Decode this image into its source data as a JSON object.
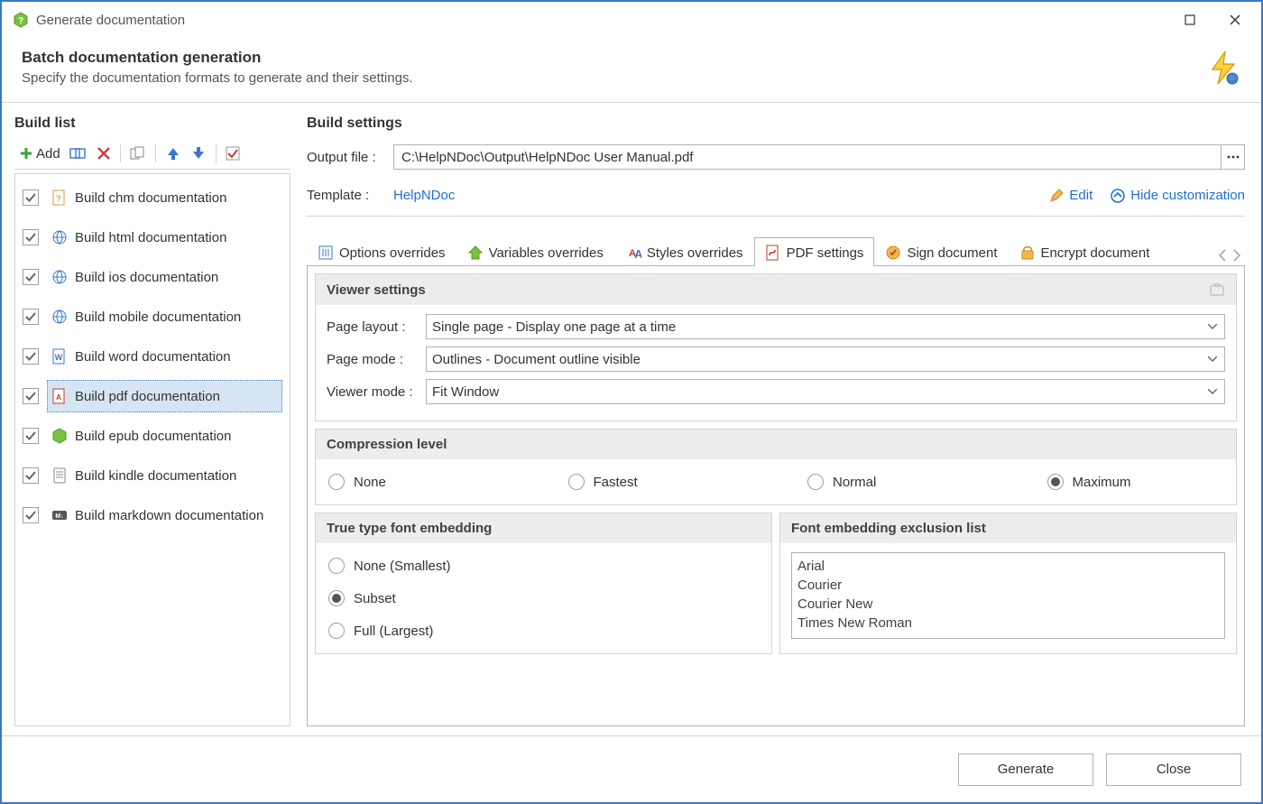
{
  "window": {
    "title": "Generate documentation"
  },
  "banner": {
    "title": "Batch documentation generation",
    "subtitle": "Specify the documentation formats to generate and their settings."
  },
  "side": {
    "heading": "Build list",
    "add_label": "Add",
    "items": [
      {
        "label": "Build chm documentation",
        "checked": true,
        "icon": "chm"
      },
      {
        "label": "Build html documentation",
        "checked": true,
        "icon": "html"
      },
      {
        "label": "Build ios documentation",
        "checked": true,
        "icon": "ios"
      },
      {
        "label": "Build mobile documentation",
        "checked": true,
        "icon": "mobile"
      },
      {
        "label": "Build word documentation",
        "checked": true,
        "icon": "word"
      },
      {
        "label": "Build pdf documentation",
        "checked": true,
        "icon": "pdf",
        "selected": true
      },
      {
        "label": "Build epub documentation",
        "checked": true,
        "icon": "epub"
      },
      {
        "label": "Build kindle documentation",
        "checked": true,
        "icon": "kindle"
      },
      {
        "label": "Build markdown documentation",
        "checked": true,
        "icon": "md"
      }
    ]
  },
  "settings": {
    "heading": "Build settings",
    "output_label": "Output file :",
    "output_value": "C:\\HelpNDoc\\Output\\HelpNDoc User Manual.pdf",
    "template_label": "Template :",
    "template_value": "HelpNDoc",
    "edit_label": "Edit",
    "hide_label": "Hide customization",
    "tabs": [
      "Options overrides",
      "Variables overrides",
      "Styles overrides",
      "PDF settings",
      "Sign document",
      "Encrypt document"
    ],
    "active_tab": 3,
    "viewer": {
      "title": "Viewer settings",
      "rows": [
        {
          "label": "Page layout :",
          "value": "Single page - Display one page at a time"
        },
        {
          "label": "Page mode :",
          "value": "Outlines - Document outline visible"
        },
        {
          "label": "Viewer mode :",
          "value": "Fit Window"
        }
      ]
    },
    "compression": {
      "title": "Compression level",
      "options": [
        "None",
        "Fastest",
        "Normal",
        "Maximum"
      ],
      "selected": 3
    },
    "font_embed": {
      "title": "True type font embedding",
      "options": [
        "None (Smallest)",
        "Subset",
        "Full (Largest)"
      ],
      "selected": 1
    },
    "font_excl": {
      "title": "Font embedding exclusion list",
      "fonts": [
        "Arial",
        "Courier",
        "Courier New",
        "Times New Roman"
      ]
    }
  },
  "footer": {
    "generate": "Generate",
    "close": "Close"
  }
}
